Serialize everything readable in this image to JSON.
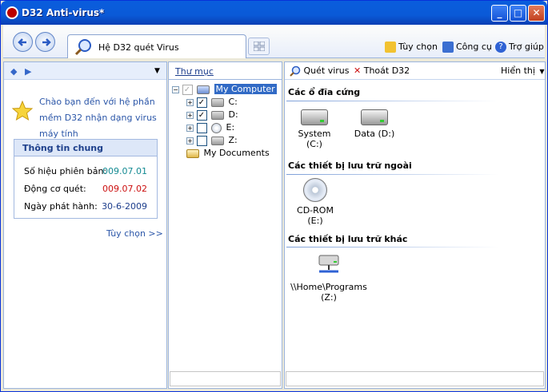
{
  "window": {
    "title": "D32 Anti-virus*",
    "controls": {
      "minimize": "_",
      "maximize": "□",
      "close": "✕"
    }
  },
  "toolbar": {
    "tab_label": "Hệ D32 quét Virus",
    "options": "Tùy chọn",
    "tools": "Công cụ",
    "help": "Trợ giúp"
  },
  "left_panel": {
    "welcome_text": "Chào bạn đến với hệ phần mềm D32 nhận dạng virus máy tính",
    "info_title": "Thông tin chung",
    "rows": [
      {
        "label": "Số hiệu phiên bản:",
        "value": "009.07.01",
        "color": "#138a92"
      },
      {
        "label": "Động cơ quét:",
        "value": "009.07.02",
        "color": "#cc1010"
      },
      {
        "label": "Ngày phát hành:",
        "value": "30-6-2009",
        "color": "#1c3d8c"
      }
    ],
    "options_link": "Tùy chọn >>"
  },
  "tree": {
    "header": "Thư mục",
    "root": "My Computer",
    "drives": [
      {
        "label": "C:",
        "checked": true
      },
      {
        "label": "D:",
        "checked": true
      },
      {
        "label": "E:",
        "checked": false
      },
      {
        "label": "Z:",
        "checked": false
      }
    ],
    "documents": "My Documents"
  },
  "right_panel": {
    "scan_button": "Quét virus",
    "exit_button": "Thoát D32",
    "view_menu": "Hiển thị",
    "sections": [
      {
        "title": "Các ổ đĩa cứng",
        "items": [
          "System (C:)",
          "Data (D:)"
        ]
      },
      {
        "title": "Các thiết bị lưu trữ ngoài",
        "items": [
          "CD-ROM (E:)"
        ]
      },
      {
        "title": "Các thiết bị lưu trữ khác",
        "items": [
          "\\\\Home\\Programs (Z:)"
        ]
      }
    ]
  },
  "colors": {
    "title_bar": "#0a5ad7",
    "link_blue": "#2b56a8",
    "accent_red": "#cc1010"
  }
}
